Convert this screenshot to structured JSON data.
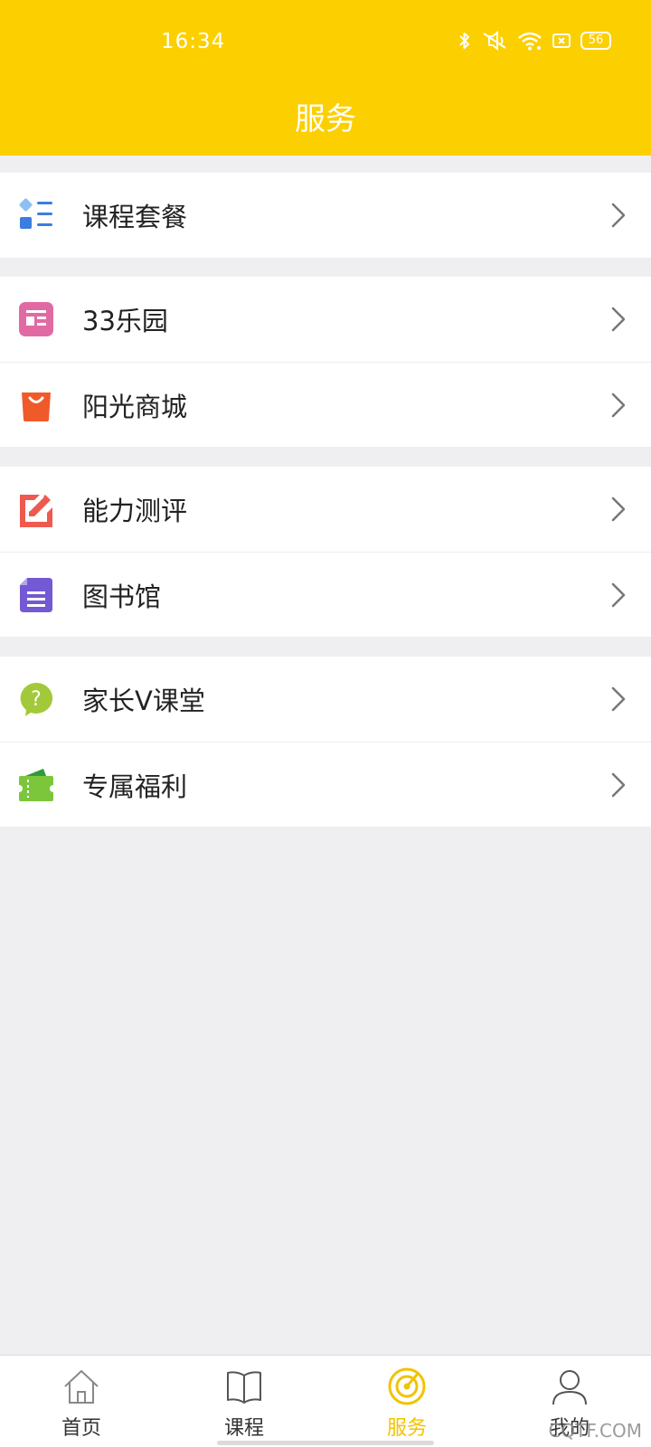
{
  "status_bar": {
    "time": "16:34",
    "battery": "56",
    "icons": [
      "bluetooth-icon",
      "mute-icon",
      "wifi-icon",
      "sim-icon",
      "battery-icon"
    ]
  },
  "header": {
    "title": "服务",
    "background_color": "#fccf00"
  },
  "groups": [
    {
      "items": [
        {
          "label": "课程套餐",
          "icon": "course-package-icon",
          "icon_color": "#3b7de0"
        }
      ]
    },
    {
      "items": [
        {
          "label": "33乐园",
          "icon": "paradise-icon",
          "icon_color": "#e26aa4"
        },
        {
          "label": "阳光商城",
          "icon": "shopping-bag-icon",
          "icon_color": "#f05a2a"
        }
      ]
    },
    {
      "items": [
        {
          "label": "能力测评",
          "icon": "edit-assessment-icon",
          "icon_color": "#ee5a4e"
        },
        {
          "label": "图书馆",
          "icon": "library-doc-icon",
          "icon_color": "#7359d3"
        }
      ]
    },
    {
      "items": [
        {
          "label": "家长V课堂",
          "icon": "question-bubble-icon",
          "icon_color": "#a2c93a"
        },
        {
          "label": "专属福利",
          "icon": "ticket-icon",
          "icon_color": "#7cc63c"
        }
      ]
    }
  ],
  "bottom_nav": {
    "active_color": "#f2c300",
    "items": [
      {
        "label": "首页",
        "icon": "home-icon"
      },
      {
        "label": "课程",
        "icon": "book-icon"
      },
      {
        "label": "服务",
        "icon": "service-radar-icon"
      },
      {
        "label": "我的",
        "icon": "profile-icon"
      }
    ]
  },
  "watermark": "CQTF.COM"
}
